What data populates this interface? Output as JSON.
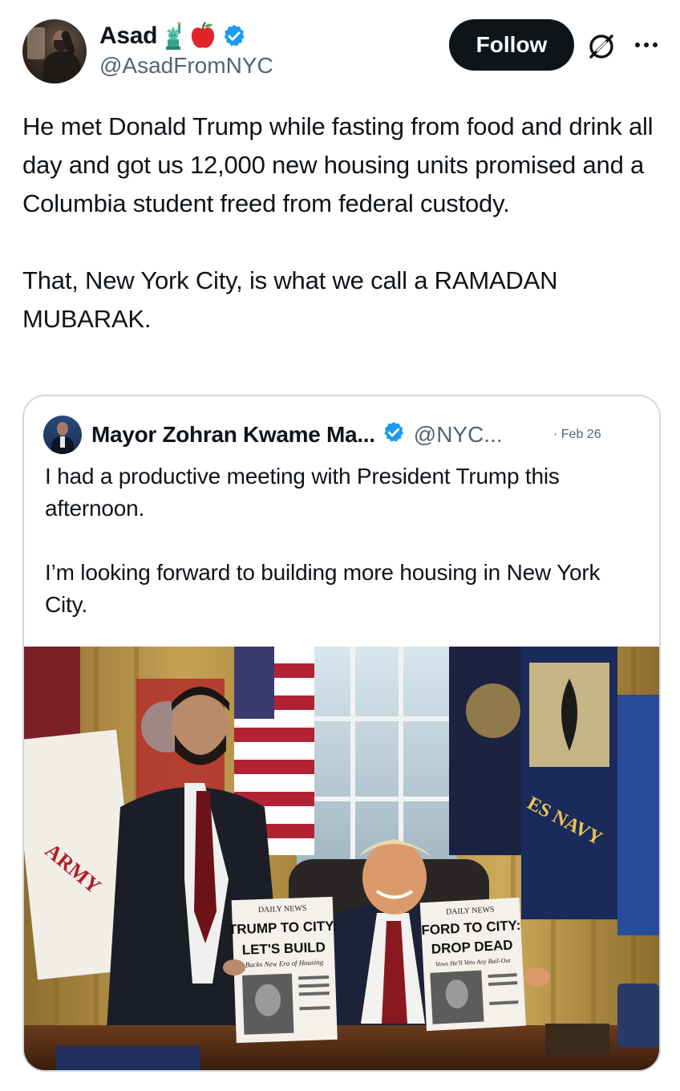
{
  "tweet": {
    "display_name": "Asad",
    "emoji_icons": [
      "statue-of-liberty-icon",
      "apple-icon"
    ],
    "verified_icon": "verified-badge-icon",
    "handle": "@AsadFromNYC",
    "follow_label": "Follow",
    "grok_icon": "grok-icon",
    "more_icon": "more-options-icon",
    "text_paragraphs": [
      "He met Donald Trump while fasting from food and drink all day and got us 12,000 new housing units promised and a Columbia student freed from federal custody.",
      "That, New York City, is what we call a RAMADAN MUBARAK."
    ]
  },
  "quoted": {
    "name": "Mayor Zohran Kwame Ma...",
    "handle": "@NYC...",
    "date": "· Feb 26",
    "text_paragraphs": [
      "I had a productive meeting with President Trump this afternoon.",
      "I’m looking forward to building more housing in New York City."
    ],
    "photo": {
      "left_paper": {
        "masthead": "DAILY NEWS",
        "headline_1": "TRUMP TO CITY:",
        "headline_2": "LET'S BUILD",
        "subhead": "Backs New Era of Housing"
      },
      "right_paper": {
        "masthead": "DAILY NEWS",
        "headline_1": "FORD TO CITY:",
        "headline_2": "DROP DEAD",
        "subhead": "Vows He'll Veto Any Bail-Out"
      },
      "flag_left": "ARMY",
      "flag_right": "ES NAVY"
    }
  },
  "colors": {
    "text": "#0f1419",
    "secondary": "#536471",
    "verified": "#1d9bf0",
    "follow_bg": "#0f1419",
    "border": "#cfd9de"
  }
}
